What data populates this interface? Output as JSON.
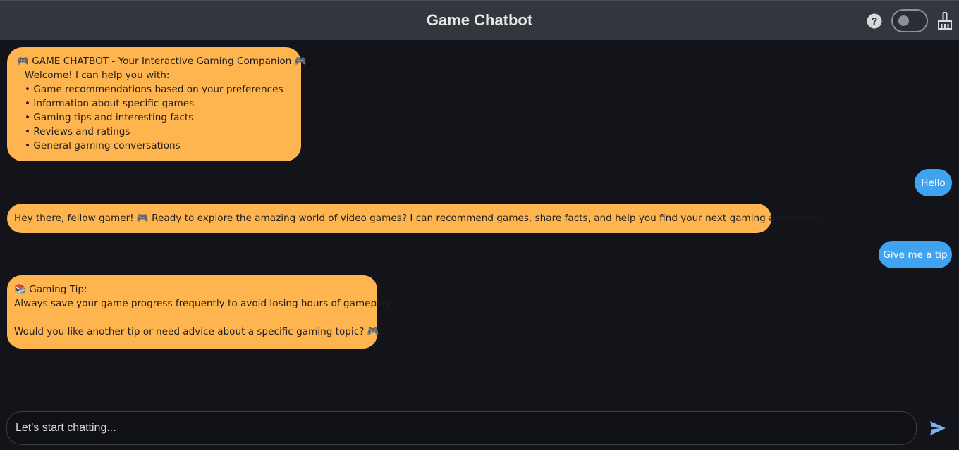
{
  "header": {
    "title": "Game Chatbot",
    "icons": [
      "help-icon",
      "theme-toggle",
      "clear-chat-icon"
    ]
  },
  "messages": {
    "welcome": {
      "sender": "bot",
      "title": "🎮 GAME CHATBOT - Your Interactive Gaming Companion 🎮",
      "intro": "Welcome! I can help you with:",
      "items": [
        "• Game recommendations based on your preferences",
        "• Information about specific games",
        "• Gaming tips and interesting facts",
        "• Reviews and ratings",
        "• General gaming conversations"
      ]
    },
    "user_1": {
      "sender": "user",
      "text": "Hello"
    },
    "bot_1": {
      "sender": "bot",
      "text": "Hey there, fellow gamer! 🎮 Ready to explore the amazing world of video games? I can recommend games, share facts, and help you find your next gaming adventure!"
    },
    "user_2": {
      "sender": "user",
      "text": "Give me a tip"
    },
    "bot_2": {
      "sender": "bot",
      "title": "📚 Gaming Tip:",
      "tip": "Always save your game progress frequently to avoid losing hours of gameplay!",
      "followup": "Would you like another tip or need advice about a specific gaming topic? 🎮"
    }
  },
  "composer": {
    "value": "",
    "placeholder": "Let's start chatting...",
    "send_icon": "send-icon"
  },
  "colors": {
    "header_bg": "#33363c",
    "page_bg": "#121419",
    "bot_bubble": "#ffb54f",
    "user_bubble": "#3fa3f0",
    "send_icon": "#7ab2f0"
  }
}
